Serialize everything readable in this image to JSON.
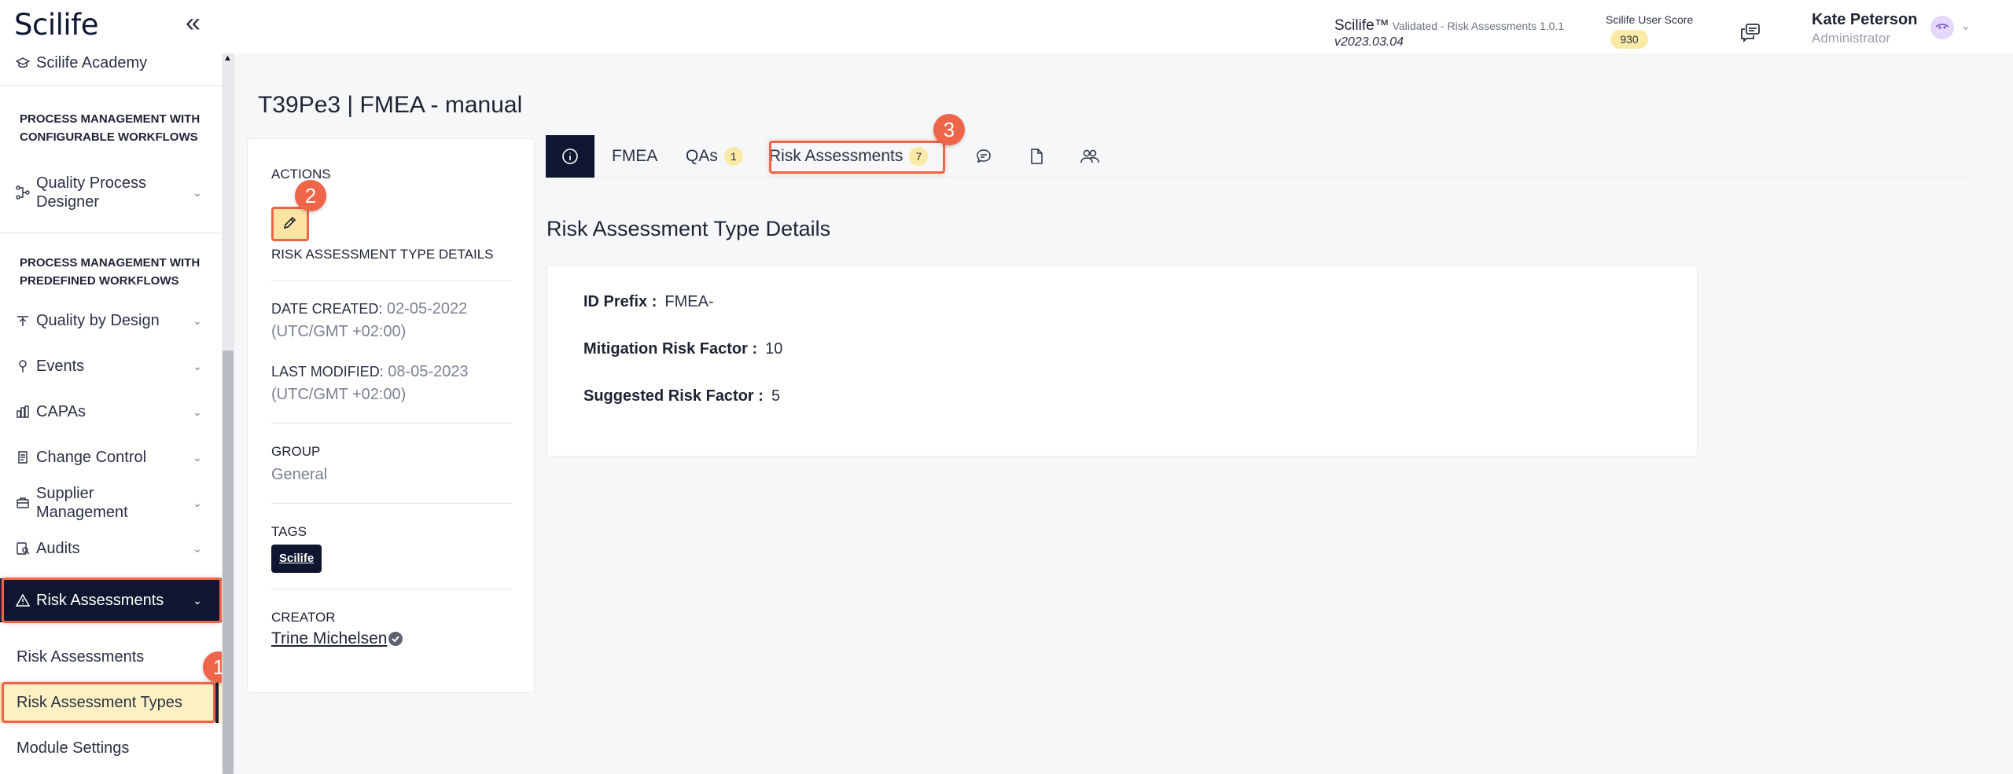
{
  "header": {
    "logo": "Scilife",
    "product_name": "Scilife™",
    "product_sub": "Validated - Risk Assessments 1.0.1",
    "version": "v2023.03.04",
    "score_label": "Scilife User Score",
    "score_value": "930",
    "user_name": "Kate Peterson",
    "user_role": "Administrator"
  },
  "sidebar": {
    "academy": "Scilife Academy",
    "section_configurable": "PROCESS MANAGEMENT WITH CONFIGURABLE WORKFLOWS",
    "quality_process_designer": "Quality Process Designer",
    "section_predefined": "PROCESS MANAGEMENT WITH PREDEFINED WORKFLOWS",
    "items": [
      {
        "label": "Quality by Design"
      },
      {
        "label": "Events"
      },
      {
        "label": "CAPAs"
      },
      {
        "label": "Change Control"
      },
      {
        "label": "Supplier Management"
      },
      {
        "label": "Audits"
      },
      {
        "label": "Risk Assessments"
      }
    ],
    "sub_items": [
      {
        "label": "Risk Assessments"
      },
      {
        "label": "Risk Assessment Types"
      },
      {
        "label": "Module Settings"
      }
    ]
  },
  "markers": [
    "1",
    "2",
    "3"
  ],
  "page": {
    "title": "T39Pe3 |  FMEA - manual"
  },
  "details_panel": {
    "actions_label": "ACTIONS",
    "type_details_label": "RISK ASSESSMENT TYPE DETAILS",
    "date_created_label": "DATE CREATED:",
    "date_created_value": "02-05-2022",
    "date_created_tz": "(UTC/GMT +02:00)",
    "last_modified_label": "LAST MODIFIED:",
    "last_modified_value": "08-05-2023",
    "last_modified_tz": "(UTC/GMT +02:00)",
    "group_label": "GROUP",
    "group_value": "General",
    "tags_label": "TAGS",
    "tag": "Scilife",
    "creator_label": "CREATOR",
    "creator_name": "Trine Michelsen"
  },
  "tabs": {
    "fmea": "FMEA",
    "qas": "QAs",
    "qas_count": "1",
    "risk_assessments": "Risk Assessments",
    "risk_assessments_count": "7"
  },
  "main": {
    "section_heading": "Risk Assessment Type Details",
    "id_prefix_label": "ID Prefix :",
    "id_prefix_value": "FMEA-",
    "mitigation_label": "Mitigation Risk Factor :",
    "mitigation_value": "10",
    "suggested_label": "Suggested Risk Factor :",
    "suggested_value": "5"
  },
  "colors": {
    "navy": "#0f1730",
    "highlight": "#ef6549",
    "badge": "#fbe9a6",
    "active_sub_bg": "#fdf1c4"
  }
}
